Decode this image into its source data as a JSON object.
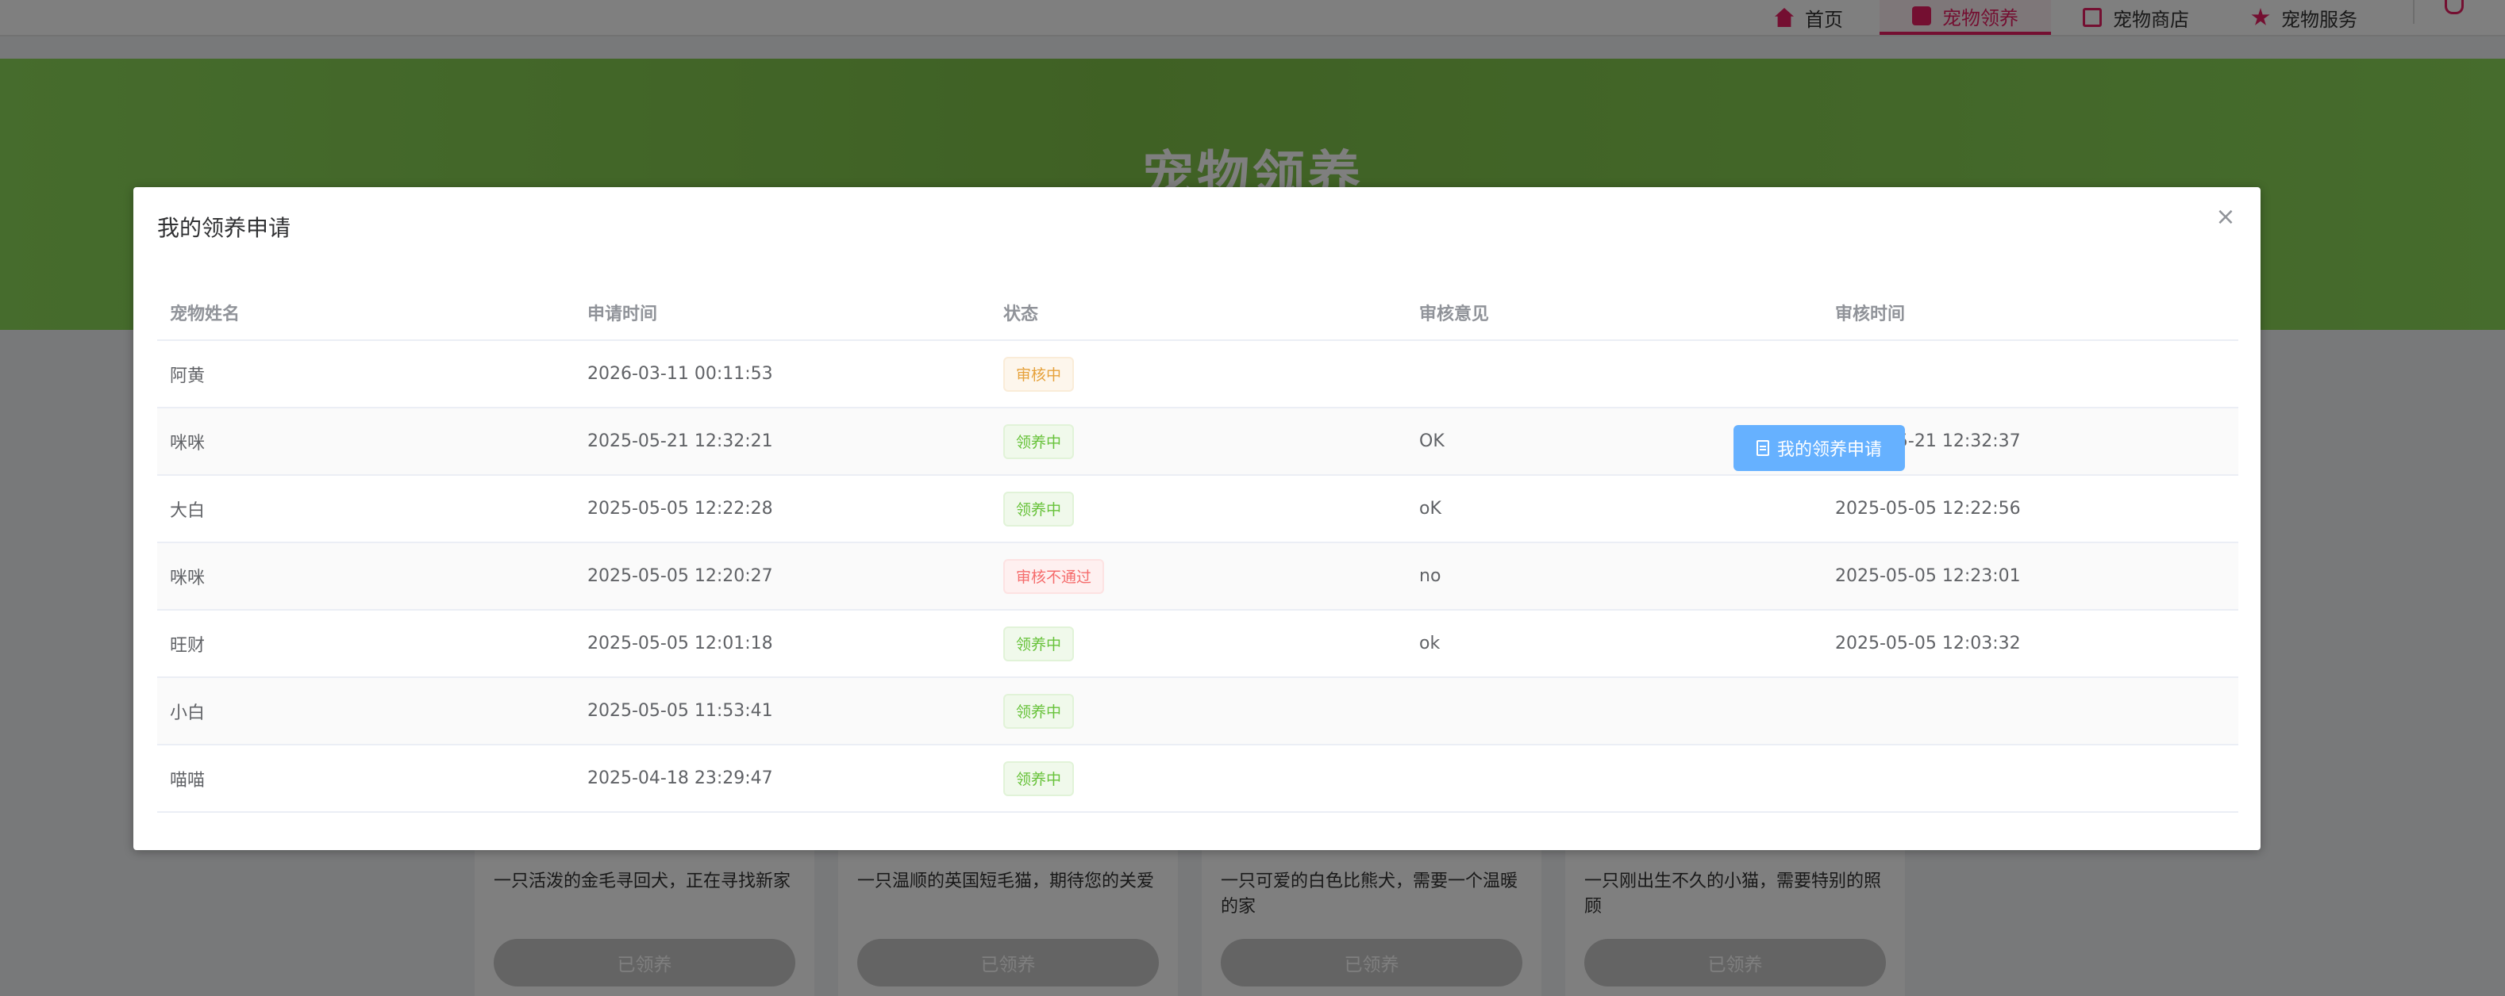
{
  "nav": {
    "items": [
      {
        "label": "首页",
        "icon": "home-icon"
      },
      {
        "label": "宠物领养",
        "icon": "paw-icon",
        "active": true
      },
      {
        "label": "宠物商店",
        "icon": "shop-icon"
      },
      {
        "label": "宠物服务",
        "icon": "star-icon"
      }
    ],
    "accent_color": "#e91e63"
  },
  "banner": {
    "title": "宠物领养"
  },
  "cards": [
    {
      "description": "一只活泼的金毛寻回犬，正在寻找新家",
      "button": "已领养"
    },
    {
      "description": "一只温顺的英国短毛猫，期待您的关爱",
      "button": "已领养"
    },
    {
      "description": "一只可爱的白色比熊犬，需要一个温暖的家",
      "button": "已领养"
    },
    {
      "description": "一只刚出生不久的小猫，需要特别的照顾",
      "button": "已领养"
    }
  ],
  "dialog": {
    "title": "我的领养申请",
    "close_icon": "close-icon",
    "columns": [
      "宠物姓名",
      "申请时间",
      "状态",
      "审核意见",
      "审核时间"
    ],
    "rows": [
      {
        "pet": "阿黄",
        "applied": "2026-03-11 00:11:53",
        "status": "审核中",
        "status_type": "warning",
        "opinion": "",
        "reviewed": ""
      },
      {
        "pet": "咪咪",
        "applied": "2025-05-21 12:32:21",
        "status": "领养中",
        "status_type": "success",
        "opinion": "OK",
        "reviewed": "2025-05-21 12:32:37"
      },
      {
        "pet": "大白",
        "applied": "2025-05-05 12:22:28",
        "status": "领养中",
        "status_type": "success",
        "opinion": "oK",
        "reviewed": "2025-05-05 12:22:56"
      },
      {
        "pet": "咪咪",
        "applied": "2025-05-05 12:20:27",
        "status": "审核不通过",
        "status_type": "danger",
        "opinion": "no",
        "reviewed": "2025-05-05 12:23:01"
      },
      {
        "pet": "旺财",
        "applied": "2025-05-05 12:01:18",
        "status": "领养中",
        "status_type": "success",
        "opinion": "ok",
        "reviewed": "2025-05-05 12:03:32"
      },
      {
        "pet": "小白",
        "applied": "2025-05-05 11:53:41",
        "status": "领养中",
        "status_type": "success",
        "opinion": "",
        "reviewed": ""
      },
      {
        "pet": "喵喵",
        "applied": "2025-04-18 23:29:47",
        "status": "领养中",
        "status_type": "success",
        "opinion": "",
        "reviewed": ""
      }
    ]
  },
  "floating_button": {
    "label": "我的领养申请",
    "icon": "document-icon",
    "color": "#66b1ff"
  }
}
